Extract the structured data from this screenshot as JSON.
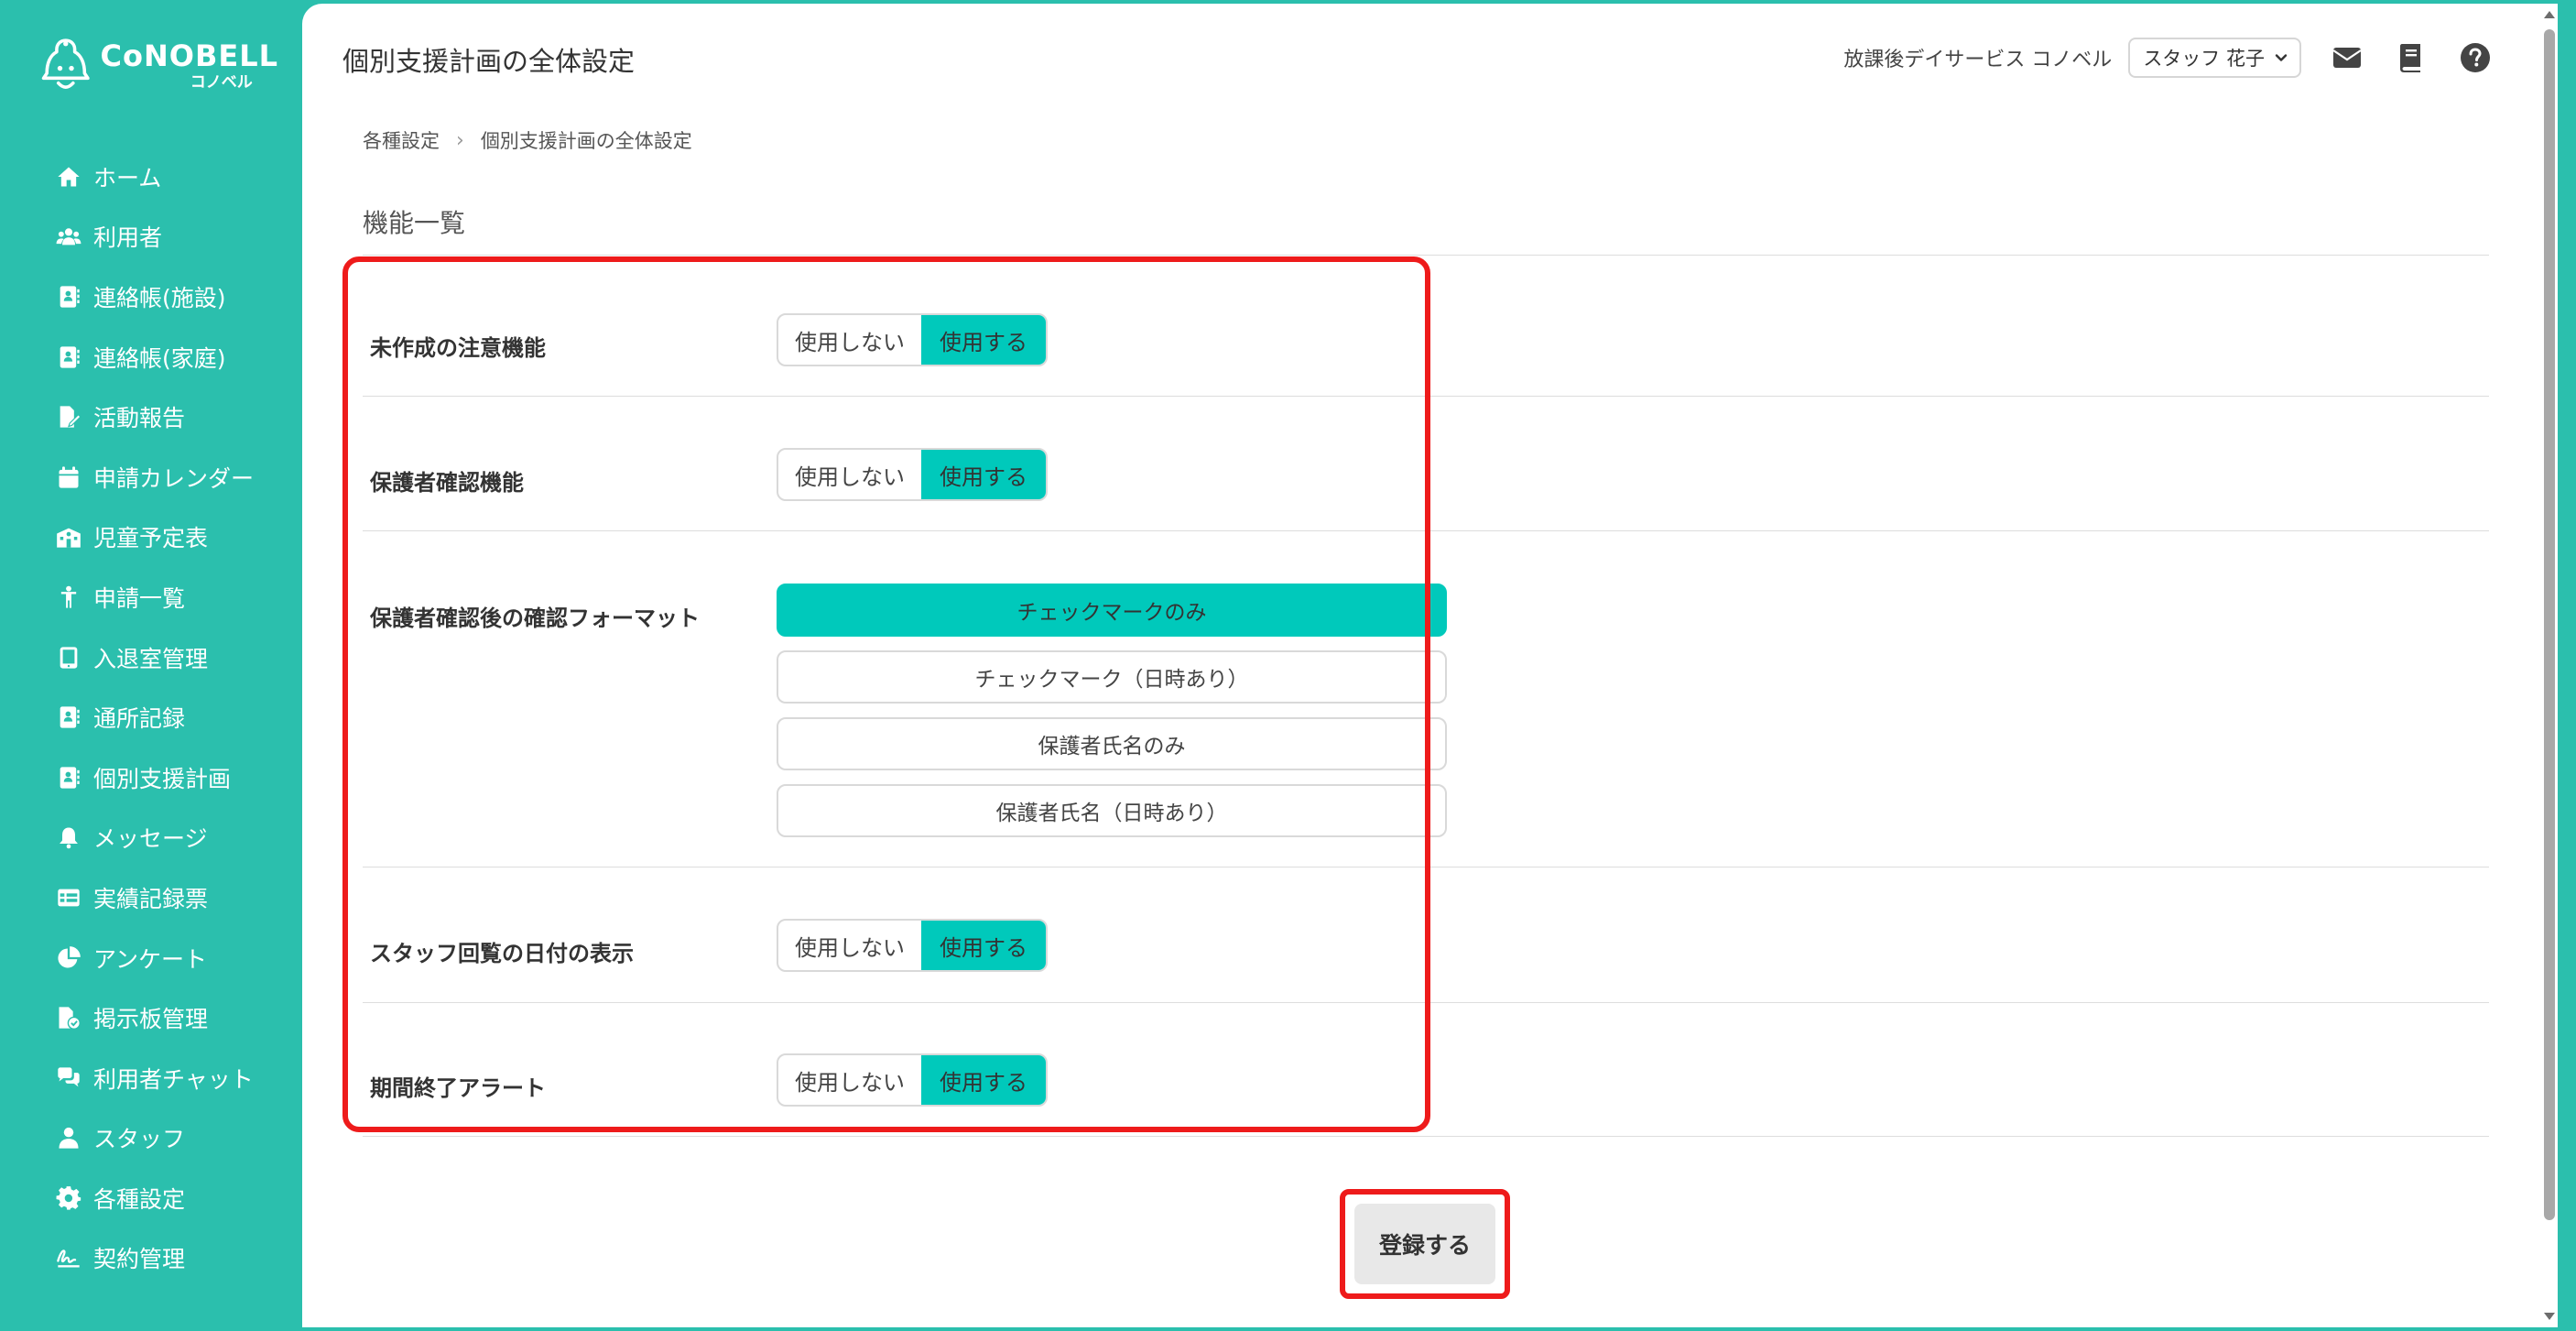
{
  "brand": {
    "name": "CoNOBELL",
    "sub": "コノベル"
  },
  "sidebar": {
    "items": [
      {
        "label": "ホーム",
        "icon": "home-icon"
      },
      {
        "label": "利用者",
        "icon": "users-icon"
      },
      {
        "label": "連絡帳(施設)",
        "icon": "contact-book-icon"
      },
      {
        "label": "連絡帳(家庭)",
        "icon": "contact-book-icon"
      },
      {
        "label": "活動報告",
        "icon": "report-edit-icon"
      },
      {
        "label": "申請カレンダー",
        "icon": "calendar-icon"
      },
      {
        "label": "児童予定表",
        "icon": "school-building-icon"
      },
      {
        "label": "申請一覧",
        "icon": "child-icon"
      },
      {
        "label": "入退室管理",
        "icon": "tablet-icon"
      },
      {
        "label": "通所記録",
        "icon": "record-book-icon"
      },
      {
        "label": "個別支援計画",
        "icon": "plan-book-icon"
      },
      {
        "label": "メッセージ",
        "icon": "bell-icon"
      },
      {
        "label": "実績記録票",
        "icon": "table-icon"
      },
      {
        "label": "アンケート",
        "icon": "pie-chart-icon"
      },
      {
        "label": "掲示板管理",
        "icon": "board-file-icon"
      },
      {
        "label": "利用者チャット",
        "icon": "chat-icon"
      },
      {
        "label": "スタッフ",
        "icon": "staff-icon"
      },
      {
        "label": "各種設定",
        "icon": "gear-icon"
      },
      {
        "label": "契約管理",
        "icon": "signature-icon"
      }
    ]
  },
  "header": {
    "title": "個別支援計画の全体設定",
    "facility": "放課後デイサービス コノベル",
    "staff": "スタッフ 花子"
  },
  "breadcrumb": {
    "parent": "各種設定",
    "current": "個別支援計画の全体設定"
  },
  "section": {
    "title": "機能一覧"
  },
  "settings": {
    "unfinished_alert": {
      "label": "未作成の注意機能",
      "off": "使用しない",
      "on": "使用する"
    },
    "guardian_confirm": {
      "label": "保護者確認機能",
      "off": "使用しない",
      "on": "使用する"
    },
    "confirm_format": {
      "label": "保護者確認後の確認フォーマット",
      "options": [
        "チェックマークのみ",
        "チェックマーク（日時あり）",
        "保護者氏名のみ",
        "保護者氏名（日時あり）"
      ],
      "selected_index": 0
    },
    "staff_view_date": {
      "label": "スタッフ回覧の日付の表示",
      "off": "使用しない",
      "on": "使用する"
    },
    "period_end_alert": {
      "label": "期間終了アラート",
      "off": "使用しない",
      "on": "使用する"
    }
  },
  "actions": {
    "submit": "登録する"
  },
  "colors": {
    "sidebar": "#2bbfad",
    "accent": "#00c9bb",
    "highlight": "#ee1b1b"
  }
}
